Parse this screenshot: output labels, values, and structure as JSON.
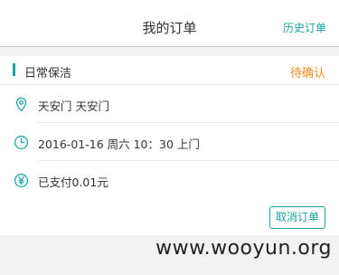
{
  "header": {
    "title": "我的订单",
    "history_label": "历史订单"
  },
  "order": {
    "service_name": "日常保洁",
    "status": "待确认",
    "address": "天安门 天安门",
    "time": "2016-01-16 周六 10：30 上门",
    "payment": "已支付0.01元",
    "cancel_label": "取消订单"
  },
  "icons": {
    "address": "location-pin-icon",
    "time": "clock-icon",
    "payment": "yuan-icon"
  },
  "colors": {
    "accent": "#1aa3a0",
    "status": "#f08a24"
  },
  "watermark": "www.wooyun.org"
}
